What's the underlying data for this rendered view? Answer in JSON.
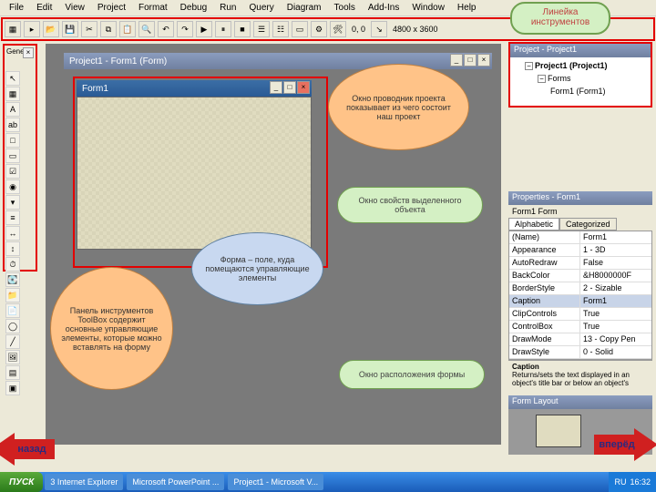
{
  "menu": [
    "File",
    "Edit",
    "View",
    "Project",
    "Format",
    "Debug",
    "Run",
    "Query",
    "Diagram",
    "Tools",
    "Add-Ins",
    "Window",
    "Help"
  ],
  "toolbar": {
    "coords": "0, 0",
    "size": "4800 x 3600"
  },
  "toolbox_title": "General",
  "project_window_title": "Project1 - Form1 (Form)",
  "form_title": "Form1",
  "label_toolbar": "Линейка инструментов",
  "callouts": {
    "explorer": "Окно проводник проекта показывает из чего состоит наш проект",
    "props": "Окно свойств выделенного объекта",
    "form": "Форма – поле, куда помещаются управляющие элементы",
    "layout": "Окно расположения формы",
    "toolbox": "Панель инструментов ToolBox содержит основные управляющие элементы, которые можно вставлять на форму"
  },
  "project_explorer": {
    "header": "Project - Project1",
    "root": "Project1 (Project1)",
    "folder": "Forms",
    "item": "Form1 (Form1)"
  },
  "properties": {
    "header": "Properties - Form1",
    "object": "Form1 Form",
    "tabs": [
      "Alphabetic",
      "Categorized"
    ],
    "rows": [
      {
        "k": "(Name)",
        "v": "Form1"
      },
      {
        "k": "Appearance",
        "v": "1 - 3D"
      },
      {
        "k": "AutoRedraw",
        "v": "False"
      },
      {
        "k": "BackColor",
        "v": "&H8000000F"
      },
      {
        "k": "BorderStyle",
        "v": "2 - Sizable"
      },
      {
        "k": "Caption",
        "v": "Form1"
      },
      {
        "k": "ClipControls",
        "v": "True"
      },
      {
        "k": "ControlBox",
        "v": "True"
      },
      {
        "k": "DrawMode",
        "v": "13 - Copy Pen"
      },
      {
        "k": "DrawStyle",
        "v": "0 - Solid"
      }
    ],
    "desc_title": "Caption",
    "desc": "Returns/sets the text displayed in an object's title bar or below an object's"
  },
  "form_layout_header": "Form Layout",
  "nav": {
    "back": "назад",
    "forward": "вперёд"
  },
  "taskbar": {
    "start": "ПУСК",
    "items": [
      "3 Internet Explorer",
      "Microsoft PowerPoint ...",
      "Project1 - Microsoft V..."
    ],
    "tray_lang": "RU",
    "tray_time": "16:32"
  }
}
